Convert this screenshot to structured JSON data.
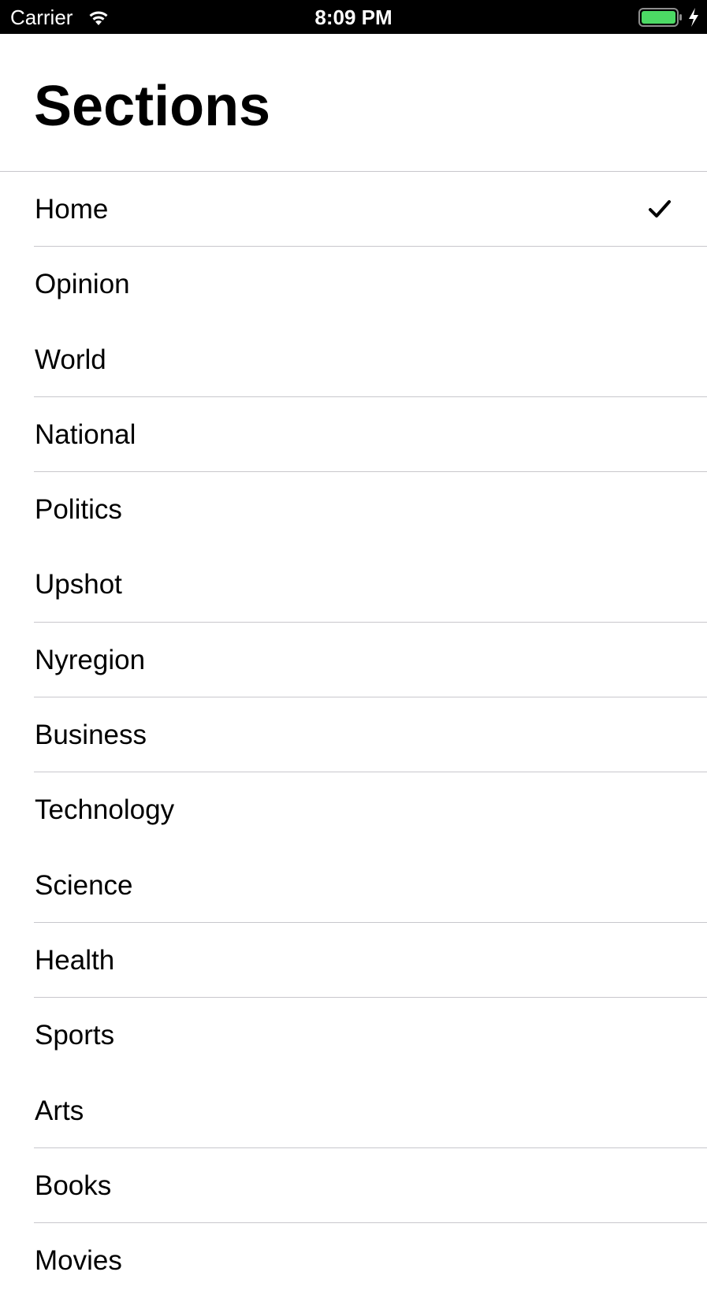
{
  "status_bar": {
    "carrier": "Carrier",
    "time": "8:09 PM",
    "battery_color": "#4cd964",
    "icons": [
      "wifi-icon",
      "battery-icon",
      "charging-bolt-icon"
    ]
  },
  "header": {
    "title": "Sections"
  },
  "sections": {
    "selected": "Home",
    "items": [
      {
        "label": "Home",
        "selected": true,
        "divider": true
      },
      {
        "label": "Opinion",
        "selected": false,
        "divider": false
      },
      {
        "label": "World",
        "selected": false,
        "divider": true
      },
      {
        "label": "National",
        "selected": false,
        "divider": true
      },
      {
        "label": "Politics",
        "selected": false,
        "divider": false
      },
      {
        "label": "Upshot",
        "selected": false,
        "divider": true
      },
      {
        "label": "Nyregion",
        "selected": false,
        "divider": true
      },
      {
        "label": "Business",
        "selected": false,
        "divider": true
      },
      {
        "label": "Technology",
        "selected": false,
        "divider": false
      },
      {
        "label": "Science",
        "selected": false,
        "divider": true
      },
      {
        "label": "Health",
        "selected": false,
        "divider": true
      },
      {
        "label": "Sports",
        "selected": false,
        "divider": false
      },
      {
        "label": "Arts",
        "selected": false,
        "divider": true
      },
      {
        "label": "Books",
        "selected": false,
        "divider": true
      },
      {
        "label": "Movies",
        "selected": false,
        "divider": false
      }
    ]
  },
  "colors": {
    "separator": "#c8c7cc",
    "text": "#000000",
    "background": "#ffffff"
  }
}
